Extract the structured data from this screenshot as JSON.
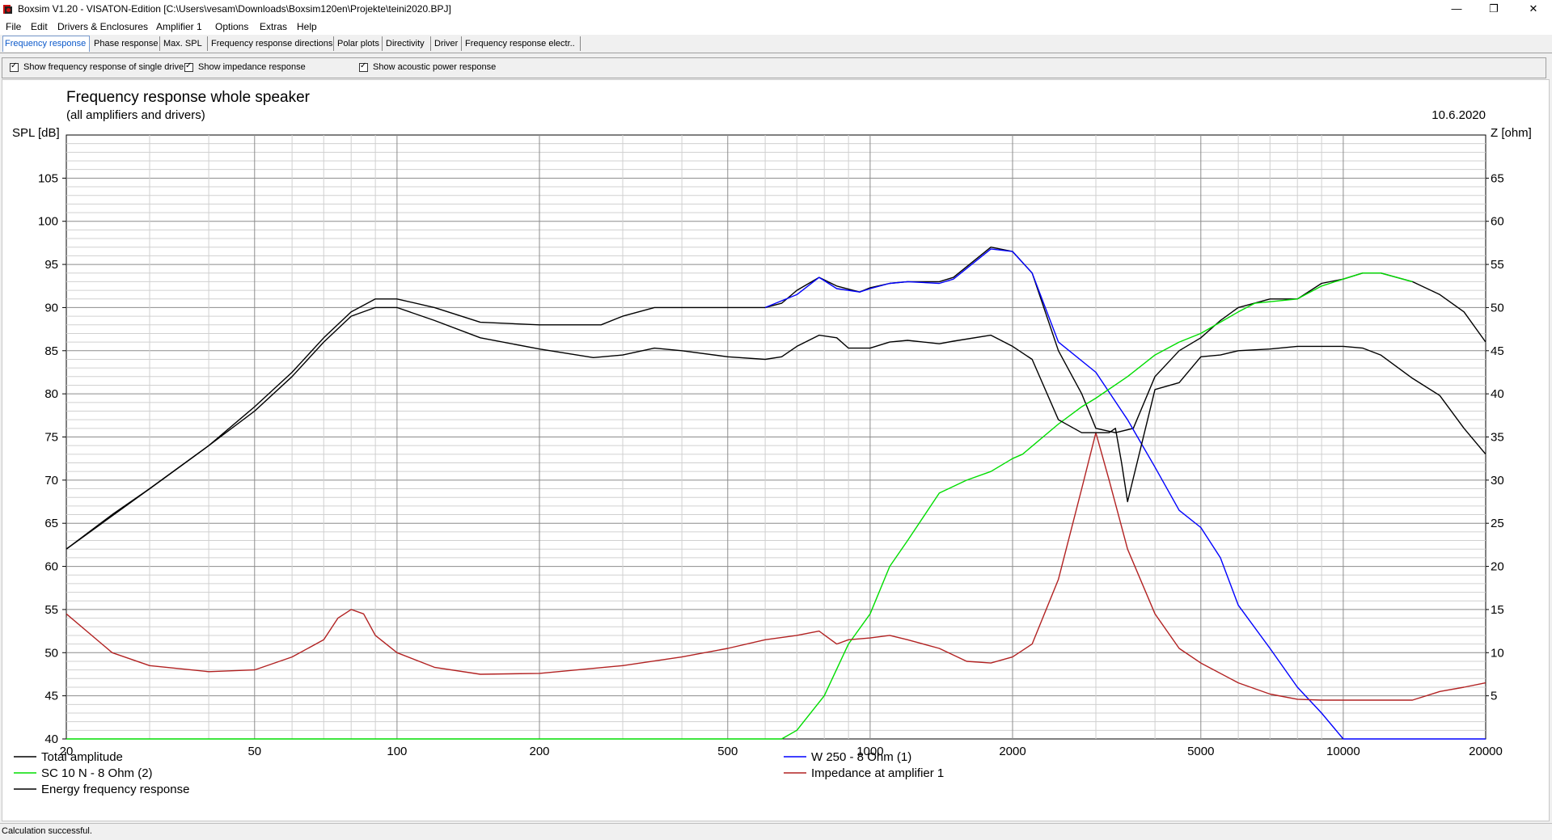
{
  "window": {
    "title": "Boxsim V1.20 - VISATON-Edition [C:\\Users\\vesam\\Downloads\\Boxsim120en\\Projekte\\teini2020.BPJ]",
    "minimize": "—",
    "maximize": "❐",
    "close": "✕"
  },
  "menu": [
    "File",
    "Edit",
    "Drivers & Enclosures",
    "Amplifier 1",
    "Options",
    "Extras",
    "Help"
  ],
  "tabs": [
    {
      "label": "Frequency response",
      "active": true
    },
    {
      "label": "Phase response"
    },
    {
      "label": "Max. SPL"
    },
    {
      "label": "Frequency response directions"
    },
    {
      "label": "Polar plots"
    },
    {
      "label": "Directivity"
    },
    {
      "label": "Driver"
    },
    {
      "label": "Frequency response electr.."
    }
  ],
  "options": [
    {
      "label": "Show frequency response of single drive",
      "checked": true
    },
    {
      "label": "Show impedance response",
      "checked": true
    },
    {
      "label": "Show acoustic power response",
      "checked": true
    }
  ],
  "chart_data": {
    "type": "line",
    "title": "Frequency response whole speaker",
    "subtitle": "(all amplifiers and drivers)",
    "date": "10.6.2020",
    "ylabel": "SPL [dB]",
    "y2label": "Z [ohm]",
    "xscale": "log",
    "xlim": [
      20,
      20000
    ],
    "ylim": [
      40,
      110
    ],
    "y2lim": [
      0,
      70
    ],
    "xticks": [
      20,
      50,
      100,
      200,
      500,
      1000,
      2000,
      5000,
      10000,
      20000
    ],
    "yticks": [
      40,
      45,
      50,
      55,
      60,
      65,
      70,
      75,
      80,
      85,
      90,
      95,
      100,
      105
    ],
    "y2ticks": [
      5,
      10,
      15,
      20,
      25,
      30,
      35,
      40,
      45,
      50,
      55,
      60,
      65
    ],
    "grid": true,
    "legend_position": "bottom",
    "series": [
      {
        "name": "Total amplitude",
        "color": "#000000",
        "axis": "left",
        "x": [
          20,
          25,
          30,
          40,
          50,
          60,
          70,
          80,
          90,
          100,
          120,
          150,
          200,
          270,
          300,
          350,
          400,
          500,
          600,
          650,
          700,
          780,
          850,
          950,
          1000,
          1100,
          1200,
          1400,
          1500,
          1800,
          2000,
          2200,
          2500,
          2800,
          3000,
          3300,
          3600,
          4000,
          4500,
          5000,
          5500,
          6000,
          7000,
          8000,
          9000,
          10000,
          11000,
          12000,
          14000,
          16000,
          18000,
          20000
        ],
        "y": [
          62,
          66,
          69,
          74,
          78.5,
          82.5,
          86.5,
          89.5,
          91,
          91,
          90,
          88.3,
          88,
          88,
          89,
          90,
          90,
          90,
          90,
          90.5,
          92,
          93.5,
          92.5,
          91.8,
          92.3,
          92.8,
          93,
          93,
          93.5,
          97,
          96.5,
          94,
          85,
          80,
          76,
          75.5,
          76,
          82,
          85,
          86.5,
          88.5,
          90,
          91,
          91,
          92.8,
          93.3,
          94,
          94,
          93,
          91.5,
          89.5,
          86
        ]
      },
      {
        "name": "W 250 - 8 Ohm (1)",
        "color": "#0000ff",
        "axis": "left",
        "x": [
          600,
          700,
          780,
          850,
          950,
          1000,
          1100,
          1200,
          1400,
          1500,
          1800,
          2000,
          2200,
          2500,
          3000,
          3500,
          4000,
          4500,
          5000,
          5500,
          6000,
          7000,
          8000,
          9000,
          10000,
          12000,
          15000,
          20000
        ],
        "y": [
          90,
          91.5,
          93.5,
          92.2,
          91.8,
          92.2,
          92.8,
          93,
          92.8,
          93.3,
          96.8,
          96.5,
          94,
          86,
          82.5,
          77,
          71.5,
          66.5,
          64.5,
          61,
          55.5,
          50.5,
          46,
          43,
          40,
          40,
          40,
          40
        ]
      },
      {
        "name": "SC 10 N - 8 Ohm (2)",
        "color": "#00dd00",
        "axis": "left",
        "x": [
          20,
          100,
          500,
          650,
          700,
          800,
          900,
          1000,
          1100,
          1200,
          1400,
          1600,
          1800,
          2000,
          2100,
          2500,
          2800,
          3000,
          3500,
          4000,
          4500,
          5000,
          6000,
          6500,
          8000,
          9000,
          10000,
          11000,
          12000,
          14000
        ],
        "y": [
          40,
          40,
          40,
          40,
          41,
          45,
          51,
          54.5,
          60,
          63,
          68.5,
          70,
          71,
          72.5,
          73,
          76.5,
          78.5,
          79.5,
          82,
          84.5,
          86,
          87,
          89.5,
          90.5,
          91,
          92.5,
          93.3,
          94,
          94,
          93
        ]
      },
      {
        "name": "Impedance at amplifier 1",
        "color": "#b22222",
        "axis": "right",
        "x": [
          20,
          25,
          30,
          40,
          50,
          60,
          70,
          75,
          80,
          85,
          90,
          100,
          120,
          150,
          200,
          300,
          400,
          500,
          600,
          700,
          780,
          850,
          900,
          1000,
          1100,
          1200,
          1400,
          1600,
          1800,
          2000,
          2200,
          2500,
          2800,
          3000,
          3200,
          3500,
          4000,
          4500,
          5000,
          6000,
          7000,
          8000,
          9000,
          10000,
          12000,
          14000,
          16000,
          18000,
          20000
        ],
        "y": [
          14.5,
          10,
          8.5,
          7.8,
          8.0,
          9.5,
          11.5,
          14,
          15,
          14.5,
          12,
          10,
          8.3,
          7.5,
          7.6,
          8.5,
          9.5,
          10.5,
          11.5,
          12,
          12.5,
          11,
          11.5,
          11.7,
          12,
          11.5,
          10.5,
          9.0,
          8.8,
          9.5,
          11.0,
          18.5,
          29,
          35.5,
          30,
          22,
          14.5,
          10.5,
          8.8,
          6.5,
          5.2,
          4.6,
          4.5,
          4.5,
          4.5,
          4.5,
          5.5,
          6.0,
          6.5
        ]
      },
      {
        "name": "Energy frequency response",
        "color": "#000000",
        "axis": "left",
        "x": [
          20,
          30,
          40,
          50,
          60,
          70,
          80,
          90,
          100,
          120,
          150,
          200,
          260,
          300,
          350,
          400,
          500,
          600,
          650,
          700,
          780,
          850,
          900,
          1000,
          1100,
          1200,
          1400,
          1500,
          1800,
          2000,
          2200,
          2500,
          2800,
          3000,
          3200,
          3300,
          3400,
          3500,
          4000,
          4500,
          5000,
          5500,
          6000,
          7000,
          8000,
          9000,
          10000,
          11000,
          12000,
          14000,
          16000,
          18000,
          20000
        ],
        "y": [
          62,
          69,
          74,
          78,
          82,
          86,
          89,
          90,
          90,
          88.5,
          86.5,
          85.2,
          84.2,
          84.5,
          85.3,
          85,
          84.3,
          84,
          84.3,
          85.5,
          86.8,
          86.5,
          85.3,
          85.3,
          86,
          86.2,
          85.8,
          86.1,
          86.8,
          85.5,
          84,
          77,
          75.5,
          75.5,
          75.5,
          76,
          72,
          67.5,
          80.5,
          81.3,
          84.3,
          84.5,
          85,
          85.2,
          85.5,
          85.5,
          85.5,
          85.3,
          84.5,
          81.8,
          79.8,
          76,
          73
        ]
      }
    ]
  },
  "status": "Calculation successful."
}
